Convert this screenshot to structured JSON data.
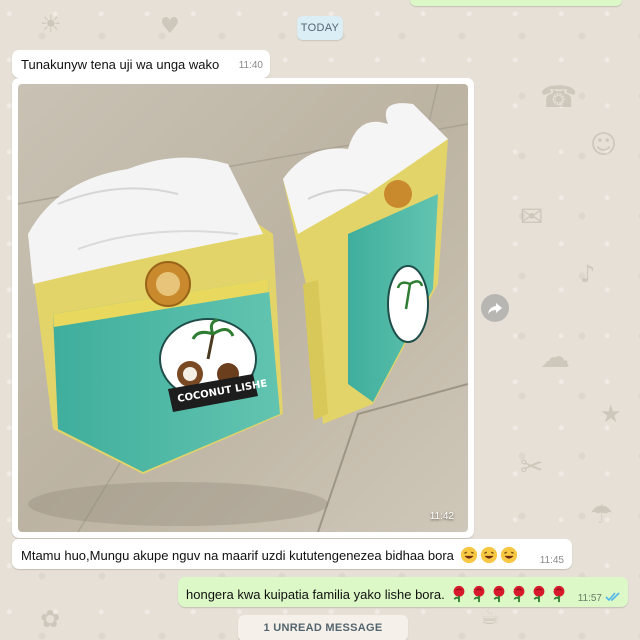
{
  "date_divider": "TODAY",
  "messages": [
    {
      "direction": "incoming",
      "type": "text",
      "text": "Tunakunyw tena uji wa unga wako",
      "time": "11:40"
    },
    {
      "direction": "incoming",
      "type": "image",
      "image_content": "Two flour packets labeled COCONUT LISHE",
      "image_label": "COCONUT LISHE",
      "time": "11:42"
    },
    {
      "direction": "incoming",
      "type": "text",
      "text": "Mtamu huo,Mungu akupe nguv na maarif uzdi kututengenezea bidhaa bora",
      "emoji": [
        "😆",
        "😆",
        "😆"
      ],
      "time": "11:45"
    },
    {
      "direction": "outgoing",
      "type": "text",
      "text": "hongera kwa kuipatia familia yako lishe bora.",
      "emoji": [
        "🌹",
        "🌹",
        "🌹",
        "🌹",
        "🌹",
        "🌹"
      ],
      "time": "11:57",
      "status": "read"
    }
  ],
  "unread_banner": "1 UNREAD MESSAGE",
  "icons": {
    "forward": "forward-icon",
    "read_receipt": "double-check-icon"
  },
  "colors": {
    "incoming_bubble": "#ffffff",
    "outgoing_bubble": "#dcf8c6",
    "read_tick": "#4fb6ec",
    "chat_background": "#e6e0d6"
  }
}
